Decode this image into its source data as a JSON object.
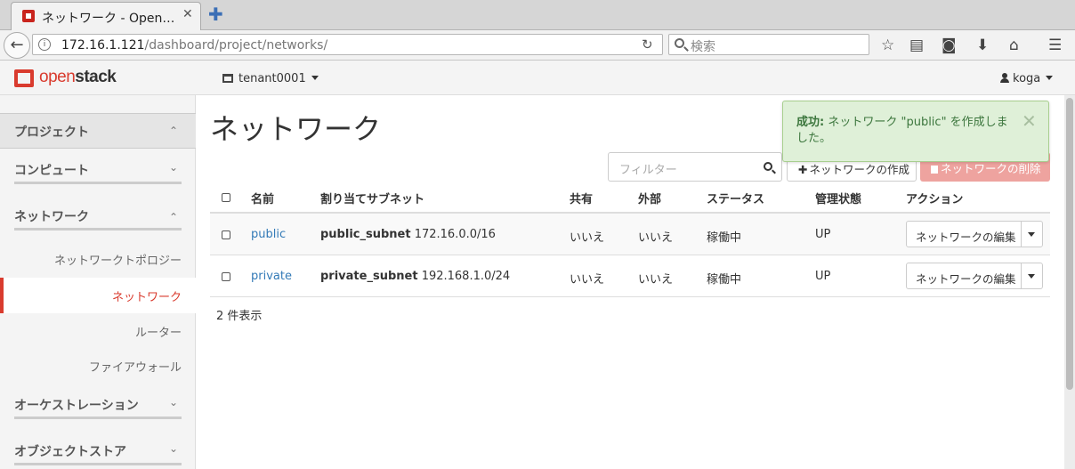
{
  "browser": {
    "tab_title": "ネットワーク - Open…",
    "tab_close": "✕",
    "new_tab": "✚",
    "back": "←",
    "url_host": "172.16.1.121",
    "url_path": "/dashboard/project/networks/",
    "search_placeholder": "検索"
  },
  "header": {
    "logo_text_light": "open",
    "logo_text_bold": "stack",
    "tenant": "tenant0001",
    "user": "koga"
  },
  "sidebar": {
    "project": "プロジェクト",
    "groups": [
      {
        "label": "コンピュート"
      },
      {
        "label": "ネットワーク"
      }
    ],
    "network_items": [
      {
        "label": "ネットワークトポロジー",
        "active": false
      },
      {
        "label": "ネットワーク",
        "active": true
      },
      {
        "label": "ルーター",
        "active": false
      },
      {
        "label": "ファイアウォール",
        "active": false
      }
    ],
    "more_groups": [
      {
        "label": "オーケストレーション"
      },
      {
        "label": "オブジェクトストア"
      }
    ]
  },
  "main": {
    "title": "ネットワーク",
    "filter_placeholder": "フィルター",
    "create_button": "ネットワークの作成",
    "delete_button": "ネットワークの削除",
    "columns": [
      "名前",
      "割り当てサブネット",
      "共有",
      "外部",
      "ステータス",
      "管理状態",
      "アクション"
    ],
    "rows": [
      {
        "name": "public",
        "subnet_name": "public_subnet",
        "subnet_cidr": "172.16.0.0/16",
        "shared": "いいえ",
        "external": "いいえ",
        "status": "稼働中",
        "admin_state": "UP",
        "action": "ネットワークの編集"
      },
      {
        "name": "private",
        "subnet_name": "private_subnet",
        "subnet_cidr": "192.168.1.0/24",
        "shared": "いいえ",
        "external": "いいえ",
        "status": "稼働中",
        "admin_state": "UP",
        "action": "ネットワークの編集"
      }
    ],
    "count_text": "2 件表示"
  },
  "toast": {
    "prefix": "成功:",
    "message": "ネットワーク \"public\" を作成しました。",
    "close": "✕"
  },
  "colors": {
    "brand_red": "#d93b2e",
    "link_blue": "#337ab7",
    "success_bg": "#dff0d8",
    "success_text": "#3c763d",
    "danger_disabled": "#eea39f"
  }
}
